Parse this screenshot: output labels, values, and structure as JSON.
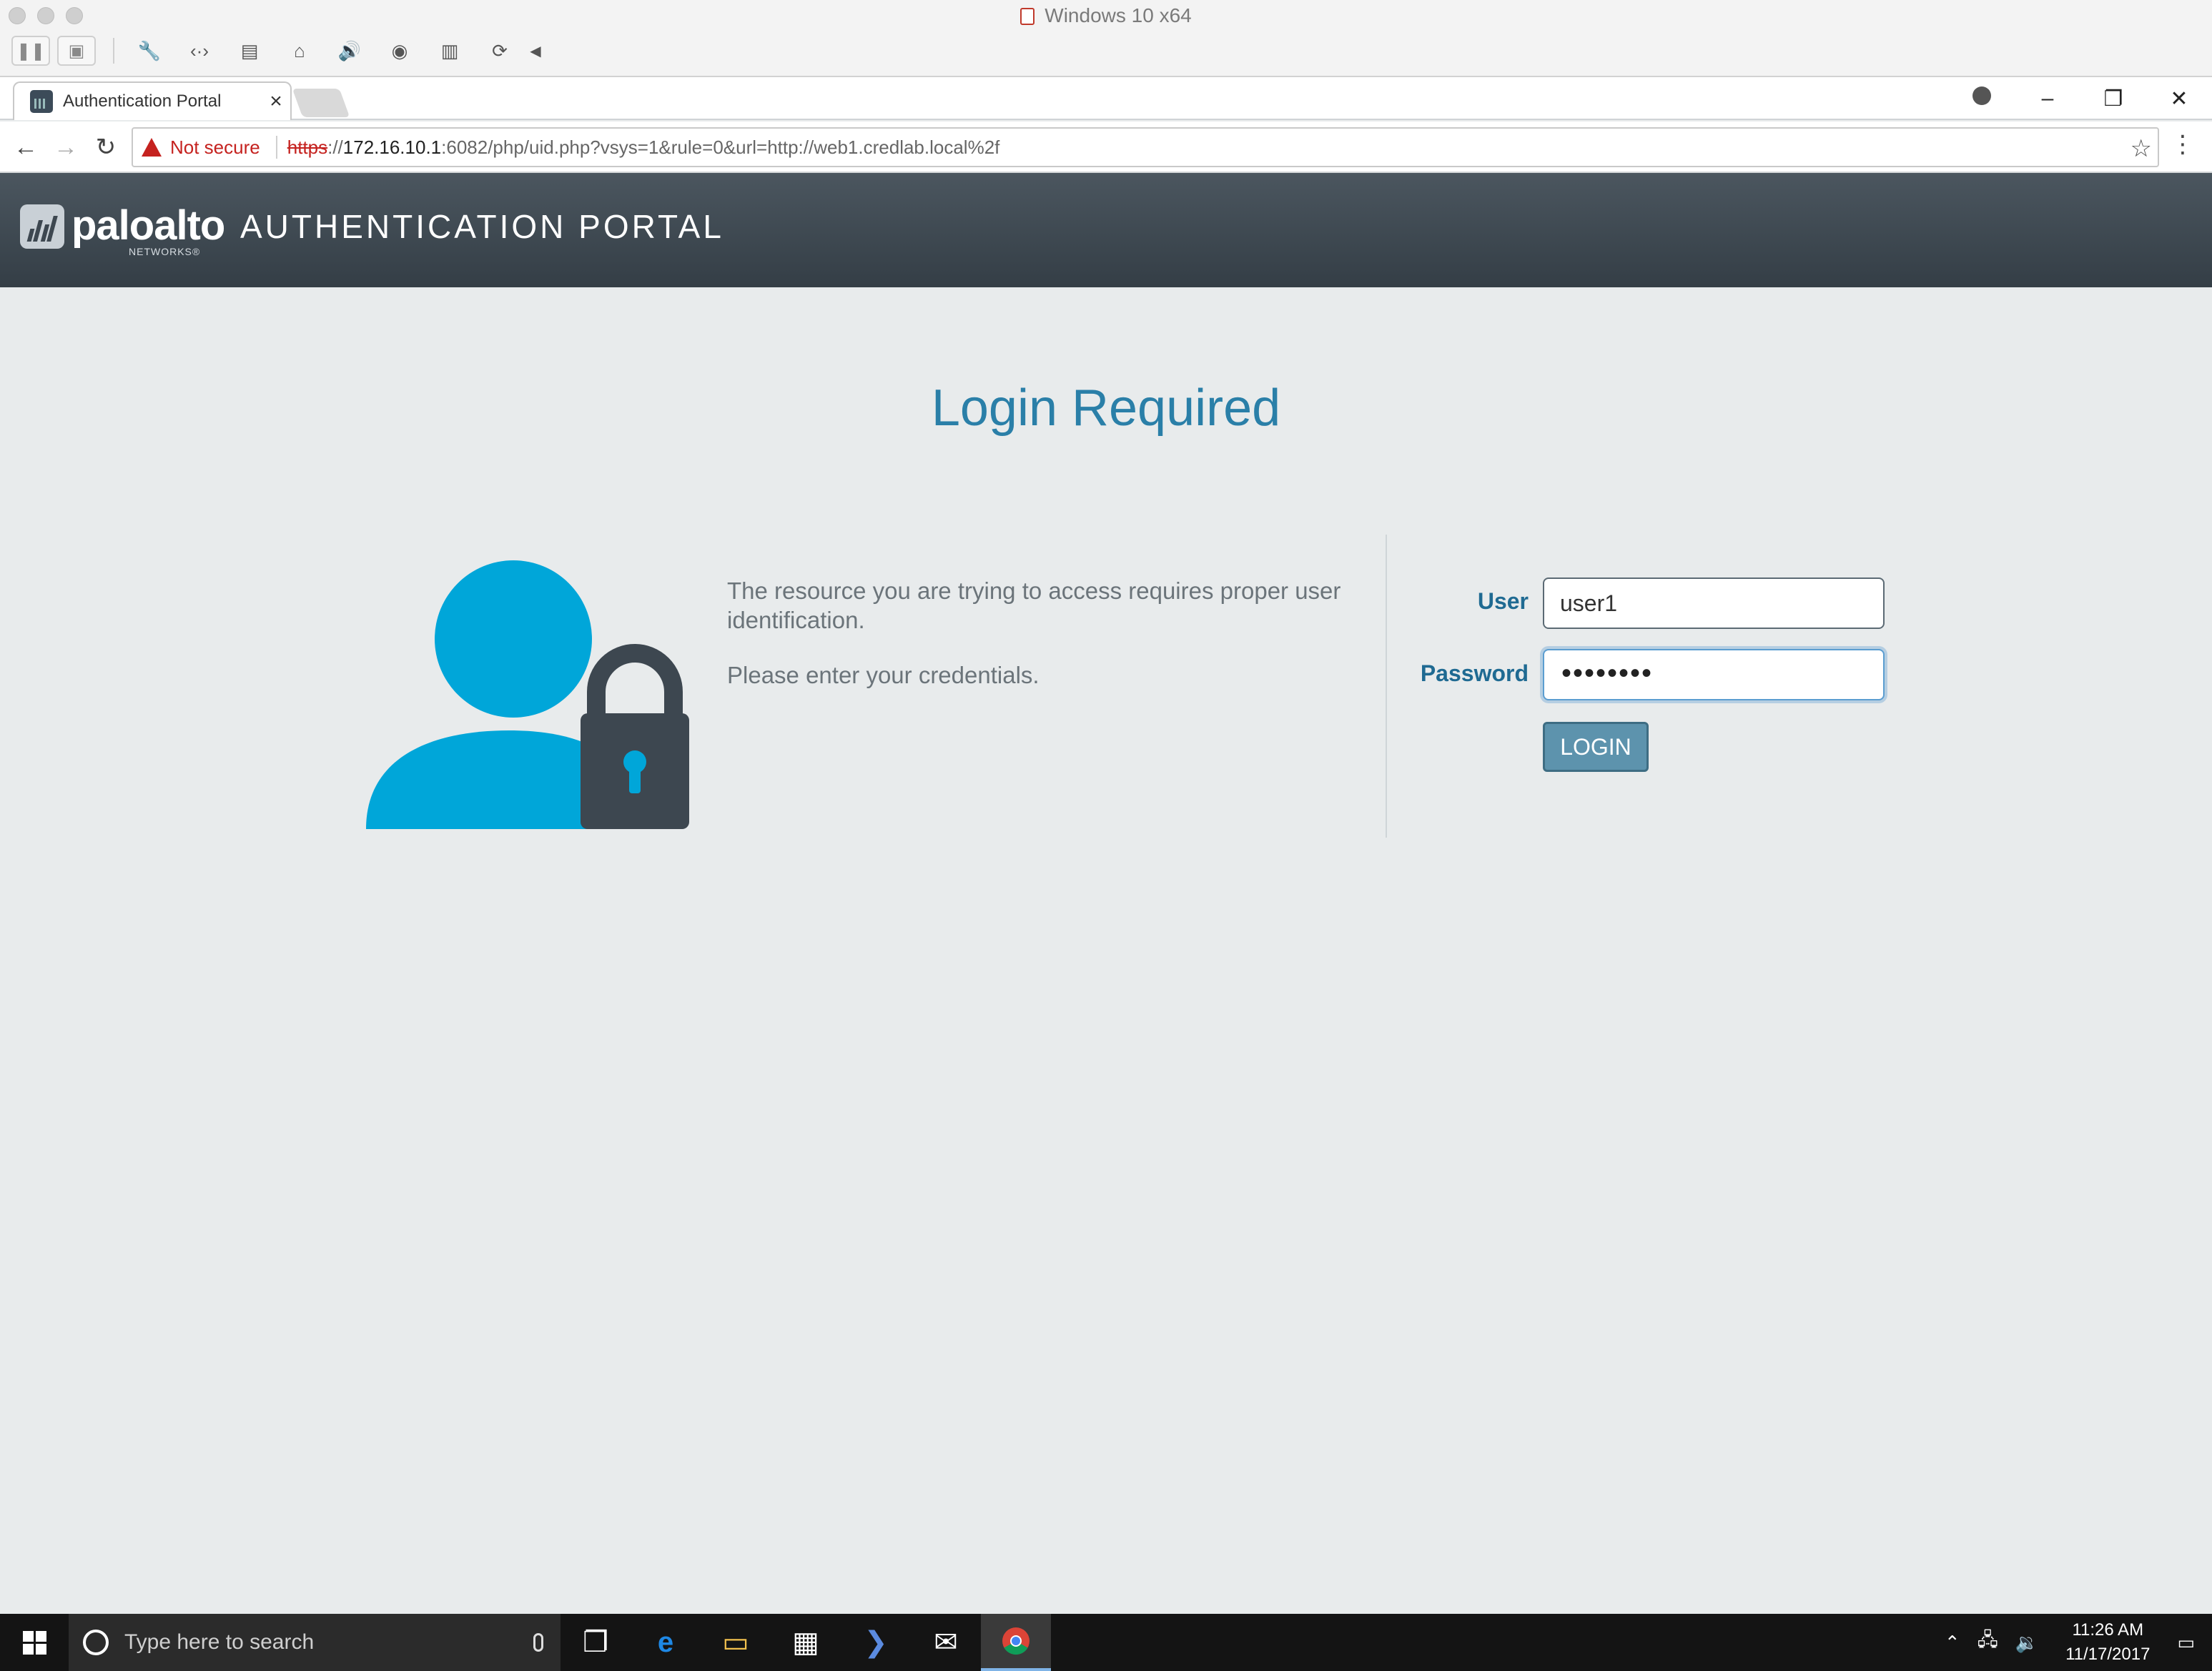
{
  "vm": {
    "window_title": "Windows 10 x64"
  },
  "browser": {
    "tab_title": "Authentication Portal",
    "tab_close": "×",
    "window_controls": {
      "minimize": "–",
      "restore": "❐",
      "close": "✕"
    },
    "nav": {
      "back": "←",
      "forward": "→",
      "reload": "↻"
    },
    "security_label": "Not secure",
    "url_scheme": "https",
    "url_sep": "://",
    "url_host": "172.16.10.1",
    "url_rest": ":6082/php/uid.php?vsys=1&rule=0&url=http://web1.credlab.local%2f",
    "bookmark": "☆",
    "menu": "⋮"
  },
  "portal": {
    "brand": "paloalto",
    "brand_sub": "NETWORKS®",
    "title": "AUTHENTICATION PORTAL",
    "heading": "Login Required",
    "message_1": "The resource you are trying to access requires proper user identification.",
    "message_2": "Please enter your credentials.",
    "user_label": "User",
    "user_value": "user1",
    "password_label": "Password",
    "password_masked": "••••••••",
    "login_button": "LOGIN",
    "colors": {
      "accent": "#00a6d9",
      "header": "#3b454d",
      "heading": "#2a7fa8",
      "lock": "#3d4750"
    }
  },
  "taskbar": {
    "search_placeholder": "Type here to search",
    "time": "11:26 AM",
    "date": "11/17/2017",
    "icons": [
      "task-view-icon",
      "edge-icon",
      "file-explorer-icon",
      "store-icon",
      "powershell-icon",
      "mail-icon",
      "chrome-icon"
    ]
  }
}
